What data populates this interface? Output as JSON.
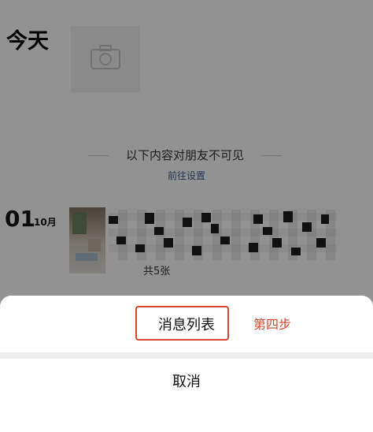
{
  "moments": {
    "section_title": "今天",
    "hidden_notice": "以下内容对朋友不可见",
    "settings_link": "前往设置",
    "post": {
      "day": "01",
      "month": "10月",
      "photo_count": "共5张"
    }
  },
  "action_sheet": {
    "option_label": "消息列表",
    "cancel_label": "取消"
  },
  "annotation": {
    "step_label": "第四步",
    "color": "#d9442b"
  }
}
